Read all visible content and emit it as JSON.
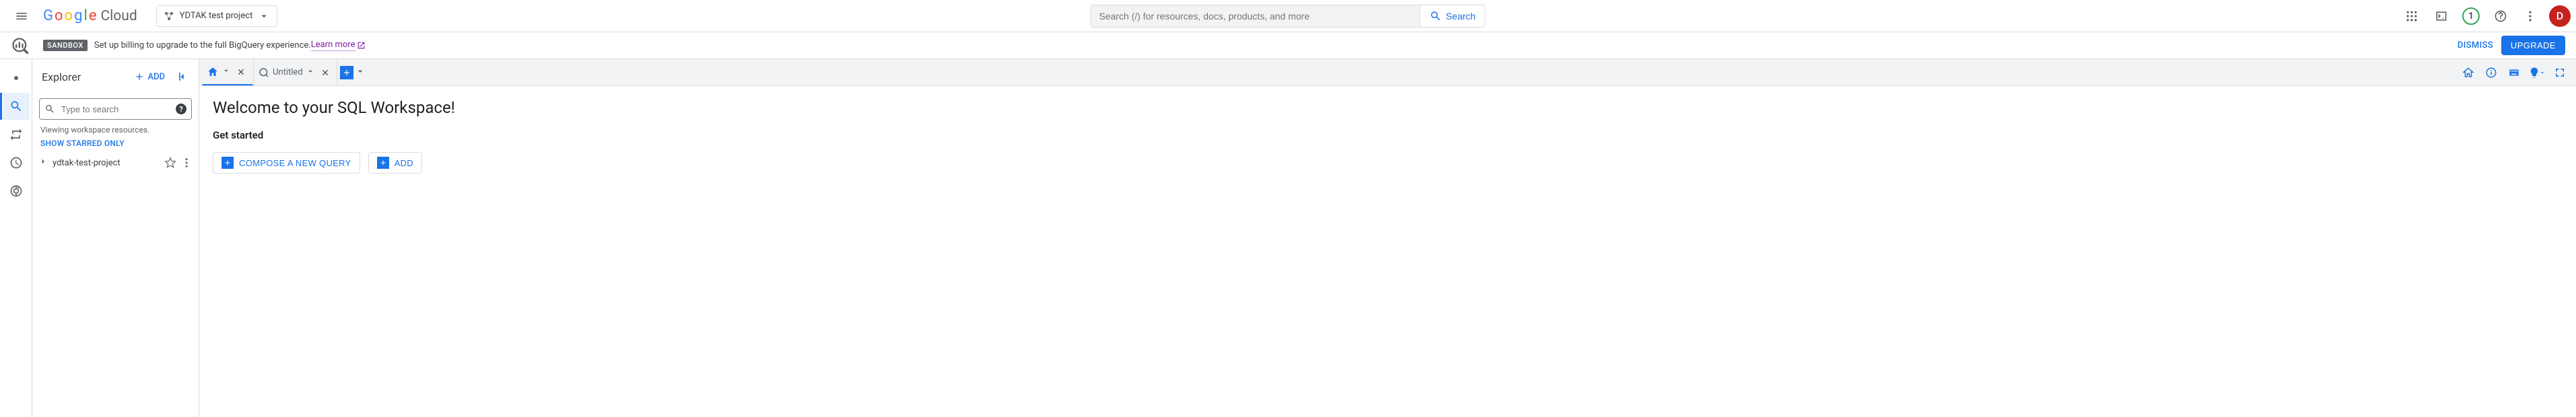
{
  "header": {
    "logo_text": "Google",
    "logo_suffix": "Cloud",
    "project_name": "YDTAK test project",
    "search_placeholder": "Search (/) for resources, docs, products, and more",
    "search_button": "Search",
    "trial_count": "1",
    "avatar_letter": "D"
  },
  "banner": {
    "badge": "SANDBOX",
    "message": "Set up billing to upgrade to the full BigQuery experience. ",
    "learn_more": "Learn more",
    "dismiss": "DISMISS",
    "upgrade": "UPGRADE"
  },
  "explorer": {
    "title": "Explorer",
    "add": "ADD",
    "search_placeholder": "Type to search",
    "viewing_text": "Viewing workspace resources.",
    "show_starred": "SHOW STARRED ONLY",
    "project_item": "ydtak-test-project"
  },
  "tabs": {
    "untitled": "Untitled"
  },
  "content": {
    "welcome": "Welcome to your SQL Workspace!",
    "get_started": "Get started",
    "compose": "COMPOSE A NEW QUERY",
    "add": "ADD"
  }
}
